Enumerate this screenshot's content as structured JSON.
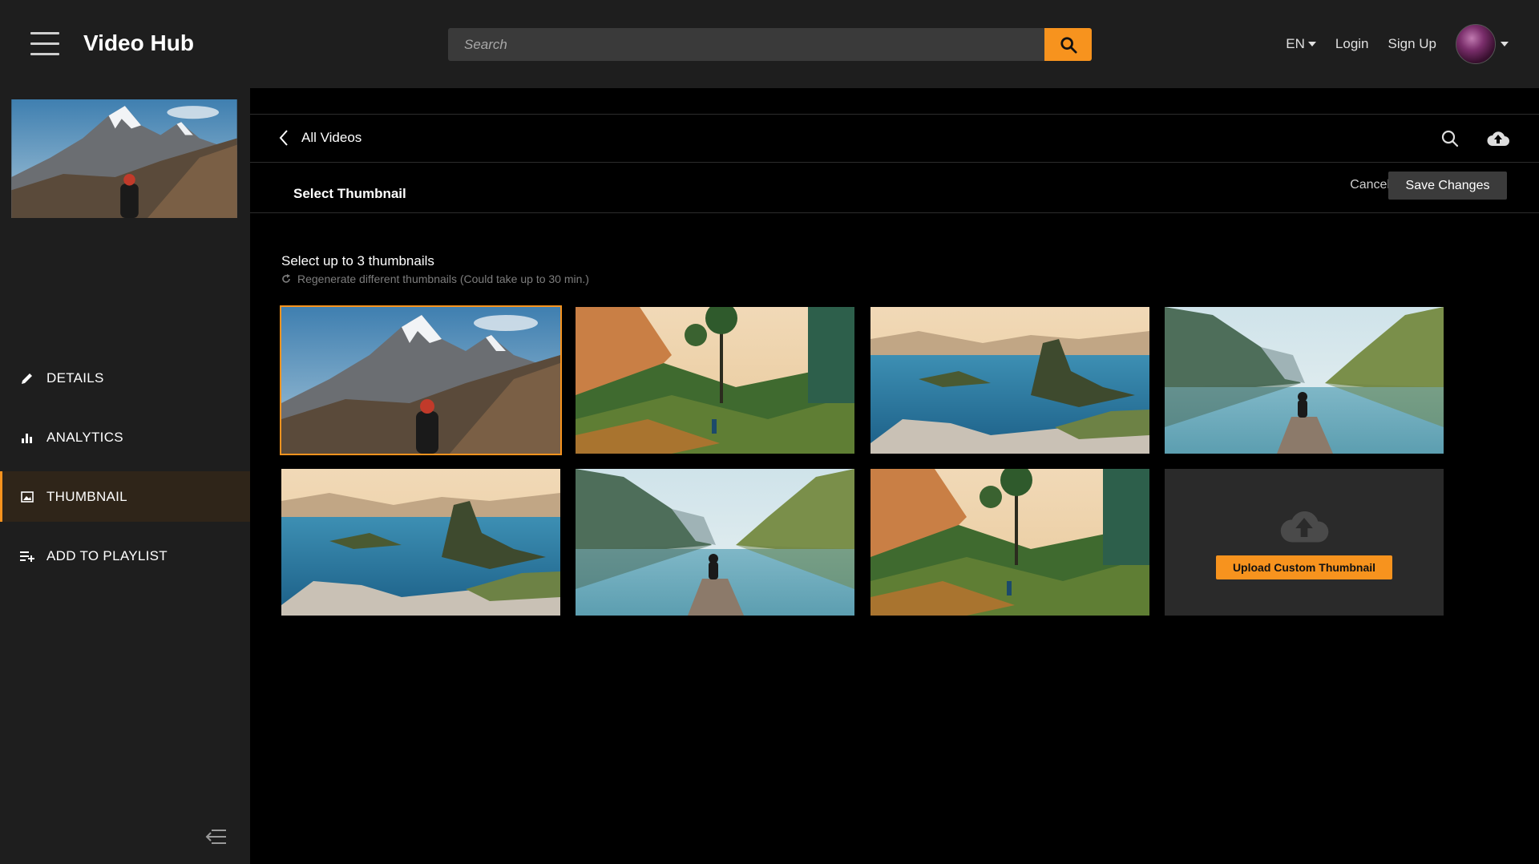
{
  "header": {
    "app_title": "Video Hub",
    "search_placeholder": "Search",
    "language": "EN",
    "login": "Login",
    "signup": "Sign Up"
  },
  "sidebar": {
    "items": [
      {
        "label": "DETAILS",
        "icon": "pencil-icon"
      },
      {
        "label": "ANALYTICS",
        "icon": "bar-chart-icon"
      },
      {
        "label": "THUMBNAIL",
        "icon": "image-icon",
        "active": true
      },
      {
        "label": "ADD TO PLAYLIST",
        "icon": "playlist-add-icon"
      }
    ]
  },
  "main": {
    "back_label": "All Videos",
    "section_title": "Select Thumbnail",
    "cancel_label": "Cancel",
    "save_label": "Save Changes",
    "select_label": "Select up to 3 thumbnails",
    "regenerate_label": "Regenerate different thumbnails (Could take up to 30 min.)",
    "upload_label": "Upload Custom Thumbnail",
    "thumbnails": [
      {
        "scene": "mountain",
        "selected": true
      },
      {
        "scene": "jungle",
        "selected": false
      },
      {
        "scene": "bay",
        "selected": false
      },
      {
        "scene": "fjord",
        "selected": false
      },
      {
        "scene": "bay",
        "selected": false
      },
      {
        "scene": "fjord",
        "selected": false
      },
      {
        "scene": "jungle",
        "selected": false
      }
    ]
  },
  "colors": {
    "accent": "#f7931e",
    "header_bg": "#1e1e1e",
    "main_bg": "#000000"
  }
}
